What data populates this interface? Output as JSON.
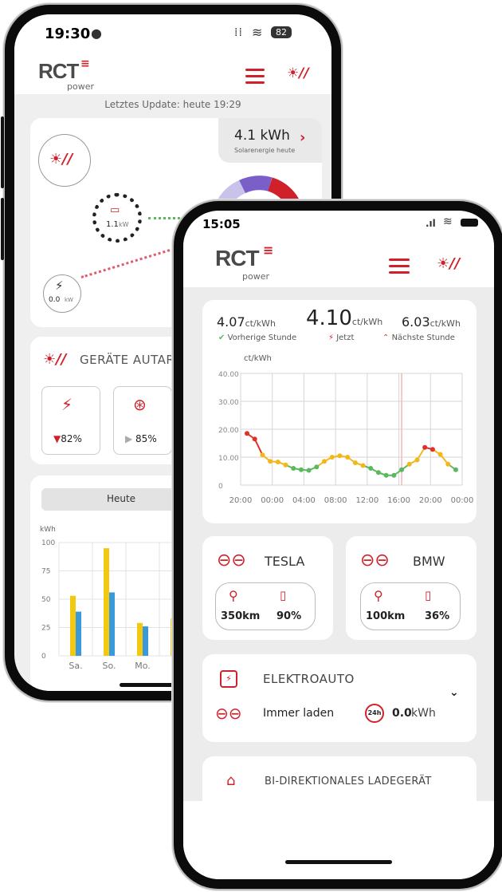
{
  "back": {
    "status_time": "19:30",
    "battery": "82",
    "logo": "RCT",
    "logo_sub": "power",
    "update_text": "Letztes Update: heute 19:29",
    "solar_value": "4.1 kWh",
    "solar_label": "Solarenergie heute",
    "battery_power": "1.1",
    "battery_unit": "kW",
    "grid_power": "0.0",
    "grid_unit": "kW",
    "autarky_title": "GERÄTE AUTARK",
    "devices": [
      {
        "percent": "82%",
        "trend": "down"
      },
      {
        "percent": "85%",
        "trend": "right"
      }
    ],
    "tab_today": "Heute",
    "chart_data": {
      "type": "bar",
      "ylabel": "kWh",
      "ylim": [
        0,
        100
      ],
      "yticks": [
        "100",
        "75",
        "50",
        "25",
        "0"
      ],
      "categories": [
        "Sa.",
        "So.",
        "Mo.",
        ""
      ],
      "series": [
        {
          "values": [
            53,
            95,
            29,
            33
          ],
          "color": "#f2c811"
        },
        {
          "values": [
            39,
            56,
            26,
            0
          ],
          "color": "#3a9ad9"
        }
      ]
    }
  },
  "front": {
    "status_time": "15:05",
    "logo": "RCT",
    "logo_sub": "power",
    "prices": {
      "prev_value": "4.07",
      "prev_unit": "ct/kWh",
      "prev_label": "Vorherige Stunde",
      "now_value": "4.10",
      "now_unit": "ct/kWh",
      "now_label": "Jetzt",
      "next_value": "6.03",
      "next_unit": "ct/kWh",
      "next_label": "Nächste Stunde"
    },
    "chart_data": {
      "type": "line",
      "ylabel": "ct/kWh",
      "ylim": [
        0,
        40
      ],
      "yticks": [
        "40.00",
        "30.00",
        "20.00",
        "10.00",
        "0"
      ],
      "xticks": [
        "20:00",
        "00:00",
        "04:00",
        "08:00",
        "12:00",
        "16:00",
        "20:00",
        "00:00"
      ],
      "current_hour_index": 20,
      "values": [
        18.5,
        16.5,
        10.8,
        8.5,
        8.3,
        7.2,
        6.0,
        5.5,
        5.3,
        6.5,
        8.5,
        10.0,
        10.5,
        10.0,
        8.0,
        7.0,
        6.0,
        4.5,
        3.5,
        3.5,
        5.5,
        7.5,
        9.0,
        13.5,
        12.8,
        11.0,
        7.5,
        5.5
      ],
      "colors": {
        "high": "#e0302a",
        "mid": "#f2b718",
        "low": "#5cb85c"
      }
    },
    "cars": [
      {
        "name": "TESLA",
        "range": "350km",
        "soc": "90%"
      },
      {
        "name": "BMW",
        "range": "100km",
        "soc": "36%"
      }
    ],
    "ev": {
      "title": "ELEKTROAUTO",
      "mode": "Immer laden",
      "badge": "24h",
      "energy_value": "0.0",
      "energy_unit": "kWh"
    },
    "bidi_title": "BI-DIREKTIONALES LADEGERÄT"
  }
}
